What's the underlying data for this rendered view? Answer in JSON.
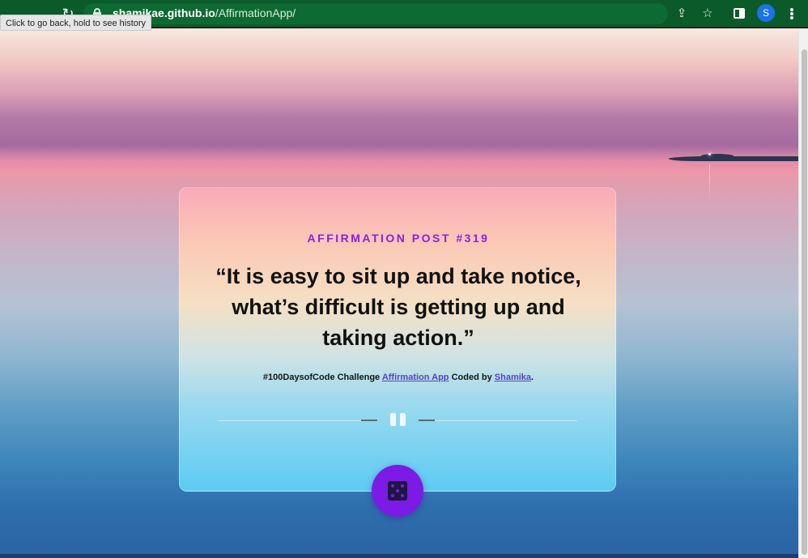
{
  "browser": {
    "url_host": "shamikae.github.io",
    "url_path": "/AffirmationApp/",
    "tooltip": "Click to go back, hold to see history",
    "profile_initial": "S"
  },
  "card": {
    "post_number": "AFFIRMATION POST #319",
    "quote": "“It is easy to sit up and take notice, what’s difficult is getting up and taking action.”",
    "credit_prefix": "#100DaysofCode Challenge ",
    "credit_app_link": "Affirmation App",
    "credit_middle": " Coded by ",
    "credit_author_link": "Shamika",
    "credit_suffix": "."
  },
  "icons": {
    "back": "arrow-left-icon",
    "forward": "arrow-right-icon",
    "reload": "reload-icon",
    "lock": "lock-icon",
    "share": "share-icon",
    "bookmark": "star-icon",
    "side_panel": "side-panel-icon",
    "menu": "kebab-menu-icon",
    "pause": "pause-icon",
    "dice": "dice-icon"
  },
  "colors": {
    "chrome": "#0b5a2a",
    "accent": "#8b1ee6",
    "dice_button": "#7c1be5",
    "link": "#5642c9"
  }
}
